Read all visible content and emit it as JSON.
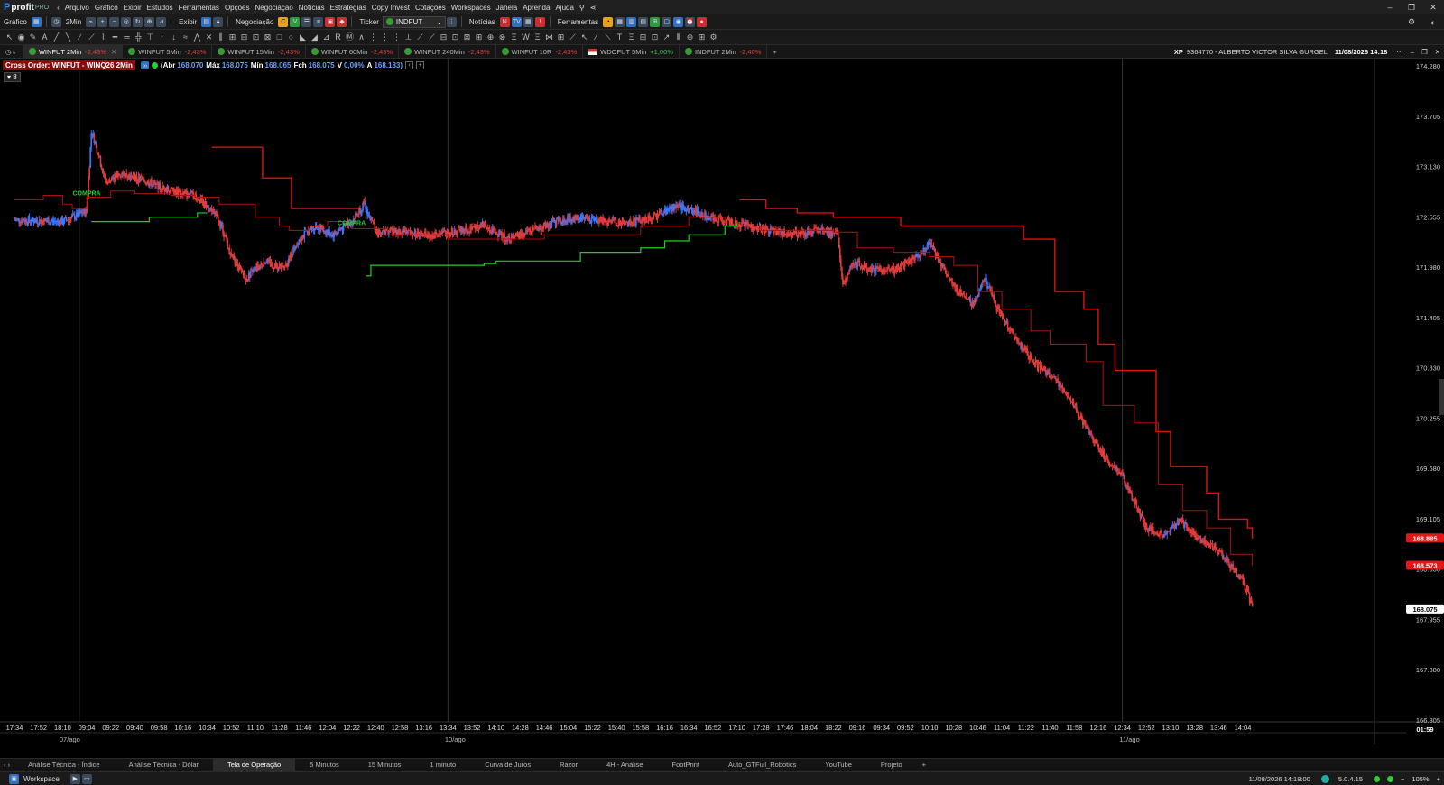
{
  "app": {
    "logo": "profit",
    "logo_suffix": "PRO"
  },
  "menu": [
    "Arquivo",
    "Gráfico",
    "Exibir",
    "Estudos",
    "Ferramentas",
    "Opções",
    "Negociação",
    "Notícias",
    "Estratégias",
    "Copy Invest",
    "Cotações",
    "Workspaces",
    "Janela",
    "Aprenda",
    "Ajuda"
  ],
  "toolbar1": {
    "grafico": "Gráfico",
    "interval": "2Min",
    "exibir": "Exibir",
    "negociacao": "Negociação",
    "ticker_label": "Ticker",
    "ticker_value": "INDFUT",
    "noticias": "Notícias",
    "ferramentas": "Ferramentas"
  },
  "chart_tabs": [
    {
      "label": "WINFUT 2Min",
      "chg": "-2,43%",
      "active": true
    },
    {
      "label": "WINFUT 5Min",
      "chg": "-2,43%"
    },
    {
      "label": "WINFUT 15Min",
      "chg": "-2,43%"
    },
    {
      "label": "WINFUT 60Min",
      "chg": "-2,43%"
    },
    {
      "label": "WINFUT 240Min",
      "chg": "-2,43%"
    },
    {
      "label": "WINFUT 10R",
      "chg": "-2,43%"
    },
    {
      "label": "WDOFUT 5Min",
      "chg": "+1,00%",
      "pos": true,
      "flag": true
    },
    {
      "label": "INDFUT 2Min",
      "chg": "-2,40%"
    }
  ],
  "account": {
    "broker": "XP",
    "id": "9364770 - ALBERTO VICTOR SILVA GURGEL",
    "datetime": "11/08/2026 14:18"
  },
  "ohlc": {
    "cross": "Cross Order: WINFUT - WINQ26 2Min",
    "abr_label": "(Abr",
    "abr": "168.070",
    "max_label": "Máx",
    "max": "168.075",
    "min_label": "Mín",
    "min": "168.065",
    "fch_label": "Fch",
    "fch": "168.075",
    "var_label": "V",
    "var": "0,00%",
    "a_label": "A",
    "a": "168.183)",
    "indicator_count": "8"
  },
  "chart_data": {
    "type": "candlestick",
    "ylim": [
      166.805,
      174.28
    ],
    "yticks": [
      "174.280",
      "173.705",
      "173.130",
      "172.555",
      "171.980",
      "171.405",
      "170.830",
      "170.255",
      "169.680",
      "169.105",
      "168.530",
      "167.955",
      "167.380",
      "166.805"
    ],
    "xticks": [
      "17:34",
      "17:52",
      "18:10",
      "09:04",
      "09:22",
      "09:40",
      "09:58",
      "10:16",
      "10:34",
      "10:52",
      "11:10",
      "11:28",
      "11:46",
      "12:04",
      "12:22",
      "12:40",
      "12:58",
      "13:16",
      "13:34",
      "13:52",
      "14:10",
      "14:28",
      "14:46",
      "15:04",
      "15:22",
      "15:40",
      "15:58",
      "16:16",
      "16:34",
      "16:52",
      "17:10",
      "17:28",
      "17:46",
      "18:04",
      "18:22",
      "09:16",
      "09:34",
      "09:52",
      "10:10",
      "10:28",
      "10:46",
      "11:04",
      "11:22",
      "11:40",
      "11:58",
      "12:16",
      "12:34",
      "12:52",
      "13:10",
      "13:28",
      "13:46",
      "14:04"
    ],
    "dates": [
      {
        "label": "07/ago",
        "at": 2
      },
      {
        "label": "10/ago",
        "at": 18
      },
      {
        "label": "11/ago",
        "at": 46
      }
    ],
    "price_path": [
      [
        0,
        172.52
      ],
      [
        2,
        172.5
      ],
      [
        3,
        172.62
      ],
      [
        3.2,
        173.55
      ],
      [
        3.8,
        172.95
      ],
      [
        4.5,
        173.05
      ],
      [
        5.5,
        172.95
      ],
      [
        6.5,
        172.85
      ],
      [
        7.5,
        172.8
      ],
      [
        8.2,
        172.65
      ],
      [
        8.6,
        172.45
      ],
      [
        9.0,
        172.1
      ],
      [
        9.6,
        171.85
      ],
      [
        10.4,
        172.05
      ],
      [
        11.2,
        171.95
      ],
      [
        11.8,
        172.3
      ],
      [
        12.5,
        172.45
      ],
      [
        13.2,
        172.35
      ],
      [
        14.0,
        172.5
      ],
      [
        14.5,
        172.7
      ],
      [
        15.0,
        172.4
      ],
      [
        16.0,
        172.38
      ],
      [
        17.5,
        172.35
      ],
      [
        18.5,
        172.4
      ],
      [
        19.5,
        172.45
      ],
      [
        20.5,
        172.3
      ],
      [
        21.5,
        172.4
      ],
      [
        22.5,
        172.5
      ],
      [
        23.5,
        172.55
      ],
      [
        24.5,
        172.5
      ],
      [
        25.5,
        172.48
      ],
      [
        26.5,
        172.55
      ],
      [
        27.5,
        172.68
      ],
      [
        28.5,
        172.6
      ],
      [
        29.5,
        172.5
      ],
      [
        30.5,
        172.45
      ],
      [
        31.5,
        172.38
      ],
      [
        32.5,
        172.36
      ],
      [
        33.5,
        172.4
      ],
      [
        34.2,
        172.35
      ],
      [
        34.4,
        171.75
      ],
      [
        34.8,
        172.05
      ],
      [
        35.5,
        171.95
      ],
      [
        36.5,
        171.95
      ],
      [
        37.5,
        172.1
      ],
      [
        38.0,
        172.25
      ],
      [
        38.5,
        172.0
      ],
      [
        39.2,
        171.7
      ],
      [
        39.8,
        171.55
      ],
      [
        40.3,
        171.85
      ],
      [
        40.8,
        171.5
      ],
      [
        41.5,
        171.2
      ],
      [
        42.3,
        170.9
      ],
      [
        43.2,
        170.7
      ],
      [
        44.0,
        170.4
      ],
      [
        44.6,
        170.1
      ],
      [
        45.3,
        169.8
      ],
      [
        46.0,
        169.6
      ],
      [
        46.5,
        169.3
      ],
      [
        47.0,
        169.0
      ],
      [
        47.8,
        168.9
      ],
      [
        48.4,
        169.1
      ],
      [
        49.0,
        168.9
      ],
      [
        49.8,
        168.8
      ],
      [
        50.4,
        168.6
      ],
      [
        51.0,
        168.4
      ],
      [
        51.4,
        168.1
      ]
    ],
    "bull_ranges": [
      [
        0,
        3.4
      ],
      [
        11.6,
        14.8
      ],
      [
        22.2,
        24.2
      ],
      [
        26.8,
        29.0
      ],
      [
        37.4,
        38.2
      ],
      [
        40.0,
        40.5
      ],
      [
        48.0,
        48.5
      ]
    ],
    "stop_upper": [
      [
        8.2,
        173.35
      ],
      [
        10.1,
        173.35
      ],
      [
        10.3,
        173.0
      ],
      [
        11.3,
        173.0
      ],
      [
        11.5,
        172.65
      ],
      [
        14.3,
        null
      ],
      [
        30.1,
        172.75
      ],
      [
        31.2,
        172.65
      ],
      [
        32.5,
        172.6
      ],
      [
        34.0,
        172.55
      ],
      [
        36.0,
        172.55
      ],
      [
        36.8,
        172.45
      ],
      [
        41.4,
        172.45
      ],
      [
        41.9,
        172.3
      ],
      [
        43.2,
        171.7
      ],
      [
        44.4,
        171.5
      ],
      [
        45.0,
        171.1
      ],
      [
        45.7,
        170.8
      ],
      [
        47.0,
        170.8
      ],
      [
        47.4,
        170.1
      ],
      [
        48.0,
        169.7
      ],
      [
        49.5,
        169.4
      ],
      [
        50.0,
        169.1
      ],
      [
        51.2,
        169.0
      ],
      [
        51.4,
        168.88
      ]
    ],
    "stop_lower": [
      [
        0,
        172.75
      ],
      [
        1.2,
        172.8
      ],
      [
        2.0,
        172.7
      ],
      [
        2.4,
        172.65
      ],
      [
        3.0,
        172.78
      ],
      [
        4.0,
        172.85
      ],
      [
        5.0,
        172.82
      ],
      [
        6.5,
        172.8
      ],
      [
        7.5,
        172.78
      ],
      [
        8.5,
        172.7
      ],
      [
        10.0,
        172.55
      ],
      [
        11.0,
        172.45
      ],
      [
        11.4,
        172.4
      ],
      [
        12.2,
        172.45
      ],
      [
        13.0,
        172.5
      ],
      [
        14.0,
        172.42
      ],
      [
        15.5,
        172.35
      ],
      [
        18.0,
        172.3
      ],
      [
        22.0,
        172.35
      ],
      [
        26.0,
        172.45
      ],
      [
        28.0,
        172.55
      ],
      [
        29.5,
        172.45
      ],
      [
        31.0,
        172.4
      ],
      [
        33.0,
        172.4
      ],
      [
        34.0,
        172.38
      ],
      [
        35.0,
        172.2
      ],
      [
        36.5,
        172.15
      ],
      [
        38.0,
        172.1
      ],
      [
        39.0,
        172.0
      ],
      [
        40.0,
        171.7
      ],
      [
        41.0,
        171.5
      ],
      [
        42.2,
        171.25
      ],
      [
        43.0,
        171.1
      ],
      [
        44.5,
        170.9
      ],
      [
        45.2,
        170.4
      ],
      [
        46.5,
        170.2
      ],
      [
        47.5,
        169.5
      ],
      [
        48.5,
        169.2
      ],
      [
        49.5,
        169.0
      ],
      [
        50.5,
        168.7
      ],
      [
        51.4,
        168.57
      ]
    ],
    "green_stop": [
      [
        3.2,
        172.5
      ],
      [
        5.5,
        172.5
      ],
      [
        5.6,
        172.55
      ],
      [
        7.5,
        172.55
      ],
      [
        7.6,
        172.6
      ],
      [
        8.0,
        172.6
      ],
      [
        null,
        null
      ],
      [
        14.6,
        171.88
      ],
      [
        14.8,
        172.0
      ],
      [
        19.5,
        172.02
      ],
      [
        20.0,
        172.05
      ],
      [
        23.0,
        172.05
      ],
      [
        23.5,
        172.15
      ],
      [
        26.0,
        172.2
      ],
      [
        27.0,
        172.28
      ],
      [
        28.0,
        172.35
      ],
      [
        29.5,
        172.45
      ],
      [
        30.0,
        172.48
      ]
    ],
    "signals": [
      {
        "label": "COMPRA",
        "at": 3.0,
        "price": 172.8
      },
      {
        "label": "COMPRA",
        "at": 14.0,
        "price": 172.46
      }
    ],
    "price_labels": [
      {
        "value": "168.885",
        "price": 168.885,
        "color": "#e01818"
      },
      {
        "value": "168.573",
        "price": 168.573,
        "color": "#e01818"
      },
      {
        "value": "168.075",
        "price": 168.075,
        "color": "#ffffff"
      }
    ],
    "time_box": "01:59",
    "colors": {
      "bull": "#3a78ff",
      "bear": "#e03c3c",
      "stop_upper": "#e01010",
      "stop_lower": "#b01010",
      "green": "#1fd01f",
      "signal": "#1fd01f"
    }
  },
  "workspace_tabs": [
    "Análise Técnica - Índice",
    "Análise Técnica - Dólar",
    "Tela de Operação",
    "5 Minutos",
    "15 Minutos",
    "1 minuto",
    "Curva de Juros",
    "Razor",
    "4H - Análise",
    "FootPrint",
    "Auto_GTFull_Robotics",
    "YouTube",
    "Projeto"
  ],
  "active_workspace": "Tela de Operação",
  "status": {
    "workspace": "Workspace",
    "datetime": "11/08/2026 14:18:00",
    "version": "5.0.4.15",
    "zoom": "105%"
  }
}
